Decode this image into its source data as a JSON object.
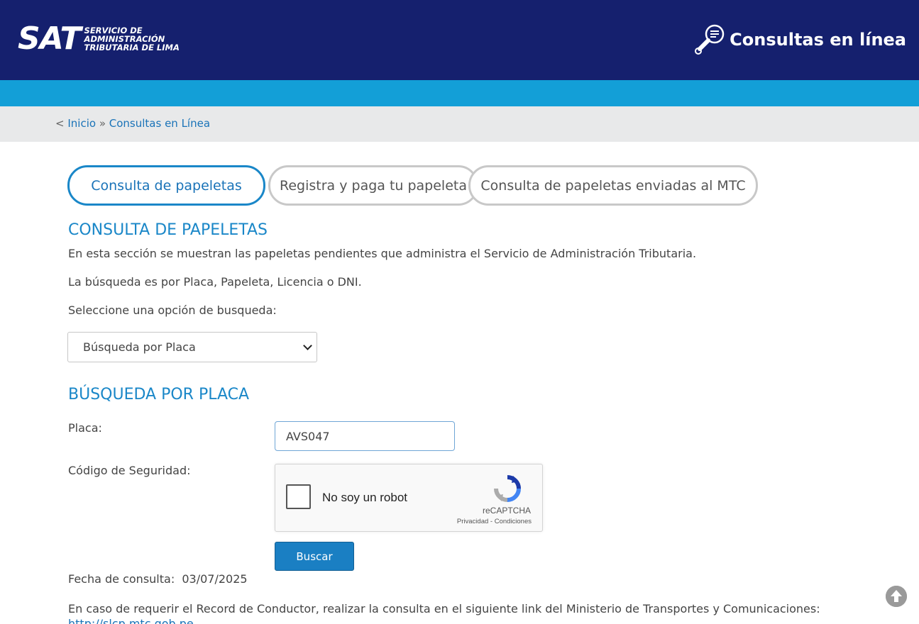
{
  "header": {
    "logo_mark": "SAT",
    "logo_lines": [
      "SERVICIO DE",
      "ADMINISTRACIÓN",
      "TRIBUTARIA DE LIMA"
    ],
    "title": "Consultas en línea"
  },
  "breadcrumb": {
    "prefix": "< ",
    "home": "Inicio",
    "separator": " » ",
    "current": "Consultas en Línea"
  },
  "tabs": [
    {
      "label": "Consulta de papeletas",
      "active": true
    },
    {
      "label": "Registra y paga tu papeleta",
      "active": false
    },
    {
      "label": "Consulta de papeletas enviadas al MTC",
      "active": false
    }
  ],
  "section": {
    "title": "CONSULTA DE PAPELETAS",
    "intro": "En esta sección se muestran las papeletas pendientes que administra el Servicio de Administración Tributaria.",
    "search_info": "La búsqueda es por Placa, Papeleta, Licencia o DNI.",
    "select_prompt": "Seleccione una opción de busqueda:",
    "select_value": "Búsqueda por Placa"
  },
  "form": {
    "title": "BÚSQUEDA POR PLACA",
    "placa_label": "Placa:",
    "placa_value": "AVS047",
    "security_label": "Código de Seguridad:",
    "captcha_label": "No soy un robot",
    "captcha_brand": "reCAPTCHA",
    "captcha_terms": "Privacidad - Condiciones",
    "submit_label": "Buscar",
    "date_label": "Fecha de consulta:",
    "date_value": "03/07/2025"
  },
  "footer_note": {
    "text": "En caso de requerir el Record de Conductor, realizar la consulta en el siguiente link del Ministerio de Transportes y Comunicaciones:",
    "link": "http://slcp.mtc.gob.pe"
  },
  "colors": {
    "navy": "#15206e",
    "cyan": "#139fd7",
    "accent": "#1a87c8"
  }
}
